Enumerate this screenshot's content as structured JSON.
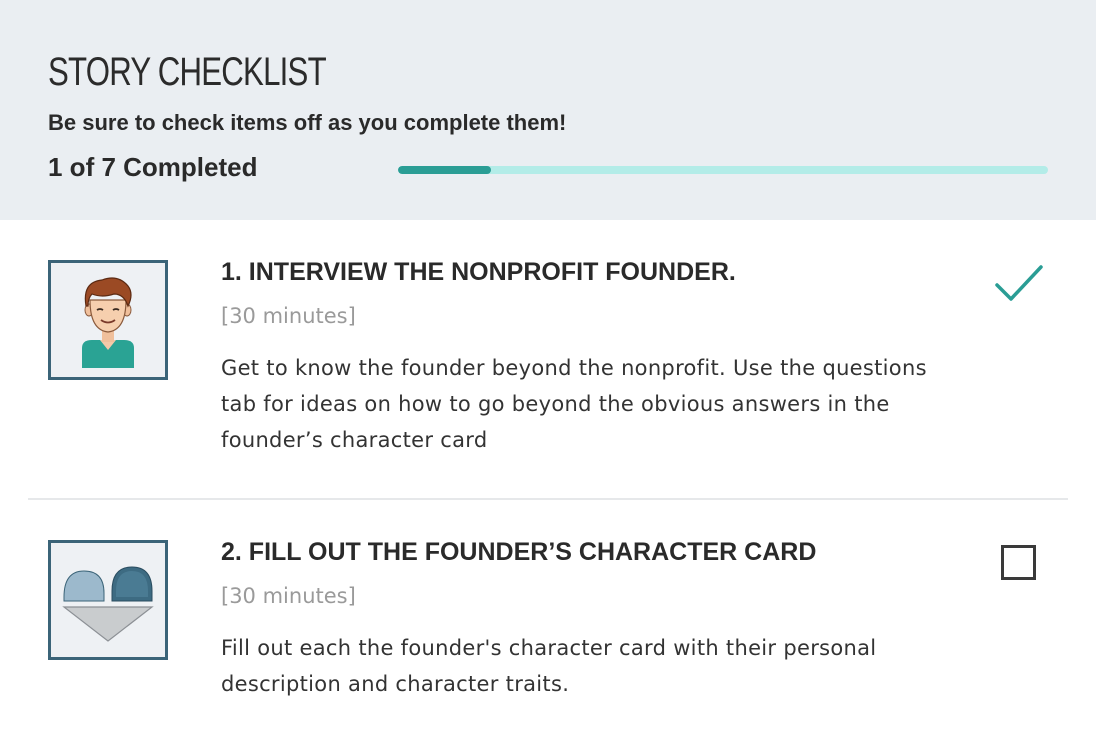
{
  "header": {
    "title": "STORY CHECKLIST",
    "subtitle": "Be sure to check items off as you complete them!",
    "progress_text": "1 of 7 Completed",
    "progress": {
      "completed": 1,
      "total": 7
    }
  },
  "colors": {
    "header_bg": "#eaeef2",
    "accent": "#2a9d95",
    "track": "#b3ece8",
    "thumb_border": "#3b6478"
  },
  "items": [
    {
      "title": "1. INTERVIEW THE NONPROFIT FOUNDER.",
      "duration": "[30 minutes]",
      "description": "Get to know the founder beyond the nonprofit. Use the questions tab for ideas on how to go beyond the obvious answers in the founder’s character card",
      "icon": "founder-avatar-icon",
      "completed": true
    },
    {
      "title": "2. FILL OUT THE FOUNDER’S CHARACTER CARD",
      "duration": "[30 minutes]",
      "description": "Fill out each the founder's character card with their personal description and character traits.",
      "icon": "heart-card-icon",
      "completed": false
    }
  ]
}
